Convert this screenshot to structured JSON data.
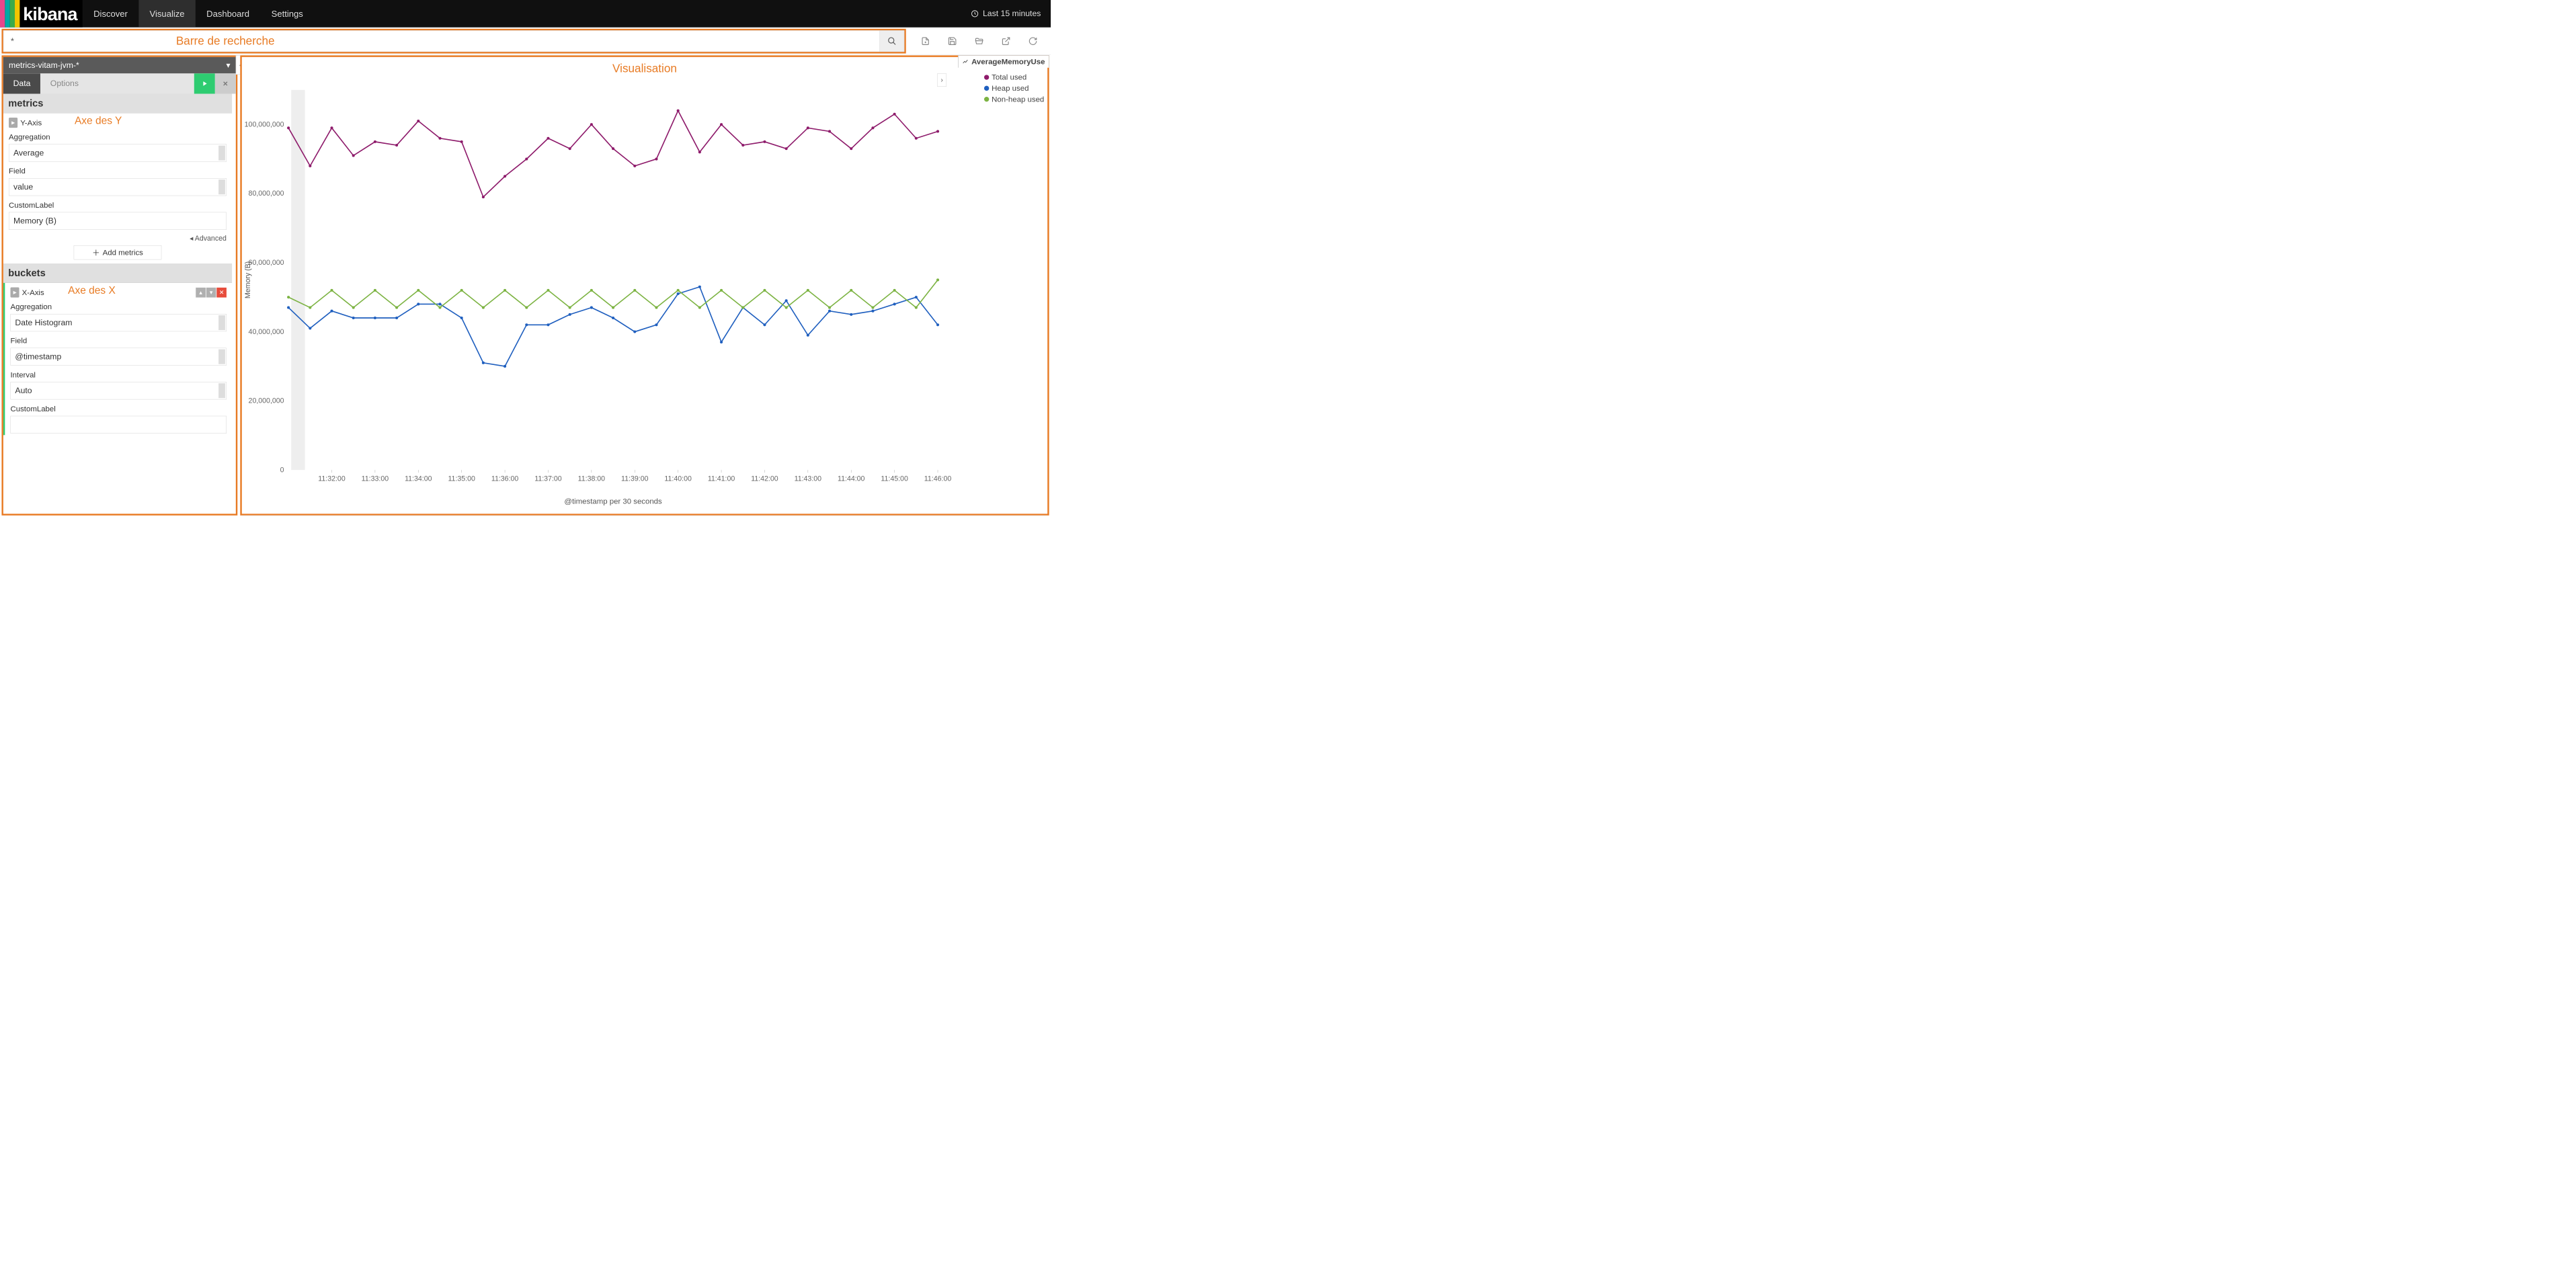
{
  "nav": {
    "items": [
      "Discover",
      "Visualize",
      "Dashboard",
      "Settings"
    ],
    "active": 1,
    "timepicker": "Last 15 minutes",
    "logo": "kibana"
  },
  "search": {
    "value": "*",
    "annotation": "Barre de recherche"
  },
  "index_pattern": "metrics-vitam-jvm-*",
  "tabs": {
    "items": [
      "Data",
      "Options"
    ],
    "active": 0
  },
  "metrics_section": {
    "title": "metrics",
    "yaxis_label": "Y-Axis",
    "annotation": "Axe des Y",
    "aggregation_label": "Aggregation",
    "aggregation_value": "Average",
    "field_label": "Field",
    "field_value": "value",
    "custom_label_label": "CustomLabel",
    "custom_label_value": "Memory (B)",
    "advanced": "Advanced",
    "add_metrics": "Add metrics"
  },
  "buckets_section": {
    "title": "buckets",
    "xaxis_label": "X-Axis",
    "annotation": "Axe des X",
    "aggregation_label": "Aggregation",
    "aggregation_value": "Date Histogram",
    "field_label": "Field",
    "field_value": "@timestamp",
    "interval_label": "Interval",
    "interval_value": "Auto",
    "custom_label_label": "CustomLabel",
    "custom_label_value": ""
  },
  "viz": {
    "annotation": "Visualisation",
    "legend_title": "AverageMemoryUse",
    "legend": [
      {
        "name": "Total used",
        "color": "#8e1b6b"
      },
      {
        "name": "Heap used",
        "color": "#1f5fbf"
      },
      {
        "name": "Non-heap used",
        "color": "#7cb342"
      }
    ],
    "x_label": "@timestamp per 30 seconds",
    "y_label": "Memory (B)"
  },
  "chart_data": {
    "type": "line",
    "xlabel": "@timestamp per 30 seconds",
    "ylabel": "Memory (B)",
    "ylim": [
      0,
      110000000
    ],
    "y_ticks": [
      0,
      20000000,
      40000000,
      60000000,
      80000000,
      100000000
    ],
    "x_ticks": [
      "11:32:00",
      "11:33:00",
      "11:34:00",
      "11:35:00",
      "11:36:00",
      "11:37:00",
      "11:38:00",
      "11:39:00",
      "11:40:00",
      "11:41:00",
      "11:42:00",
      "11:43:00",
      "11:44:00",
      "11:45:00",
      "11:46:00"
    ],
    "x": [
      "11:31:00",
      "11:31:30",
      "11:32:00",
      "11:32:30",
      "11:33:00",
      "11:33:30",
      "11:34:00",
      "11:34:30",
      "11:35:00",
      "11:35:30",
      "11:36:00",
      "11:36:30",
      "11:37:00",
      "11:37:30",
      "11:38:00",
      "11:38:30",
      "11:39:00",
      "11:39:30",
      "11:40:00",
      "11:40:30",
      "11:41:00",
      "11:41:30",
      "11:42:00",
      "11:42:30",
      "11:43:00",
      "11:43:30",
      "11:44:00",
      "11:44:30",
      "11:45:00",
      "11:45:30",
      "11:46:00"
    ],
    "series": [
      {
        "name": "Total used",
        "color": "#8e1b6b",
        "values": [
          99000000,
          88000000,
          99000000,
          91000000,
          95000000,
          94000000,
          101000000,
          96000000,
          95000000,
          79000000,
          85000000,
          90000000,
          96000000,
          93000000,
          100000000,
          93000000,
          88000000,
          90000000,
          104000000,
          92000000,
          100000000,
          94000000,
          95000000,
          93000000,
          99000000,
          98000000,
          93000000,
          99000000,
          103000000,
          96000000,
          98000000
        ]
      },
      {
        "name": "Heap used",
        "color": "#1f5fbf",
        "values": [
          47000000,
          41000000,
          46000000,
          44000000,
          44000000,
          44000000,
          48000000,
          48000000,
          44000000,
          31000000,
          30000000,
          42000000,
          42000000,
          45000000,
          47000000,
          44000000,
          40000000,
          42000000,
          51000000,
          53000000,
          37000000,
          47000000,
          42000000,
          49000000,
          39000000,
          46000000,
          45000000,
          46000000,
          48000000,
          50000000,
          42000000
        ]
      },
      {
        "name": "Non-heap used",
        "color": "#7cb342",
        "values": [
          50000000,
          47000000,
          52000000,
          47000000,
          52000000,
          47000000,
          52000000,
          47000000,
          52000000,
          47000000,
          52000000,
          47000000,
          52000000,
          47000000,
          52000000,
          47000000,
          52000000,
          47000000,
          52000000,
          47000000,
          52000000,
          47000000,
          52000000,
          47000000,
          52000000,
          47000000,
          52000000,
          47000000,
          52000000,
          47000000,
          55000000
        ]
      }
    ]
  }
}
